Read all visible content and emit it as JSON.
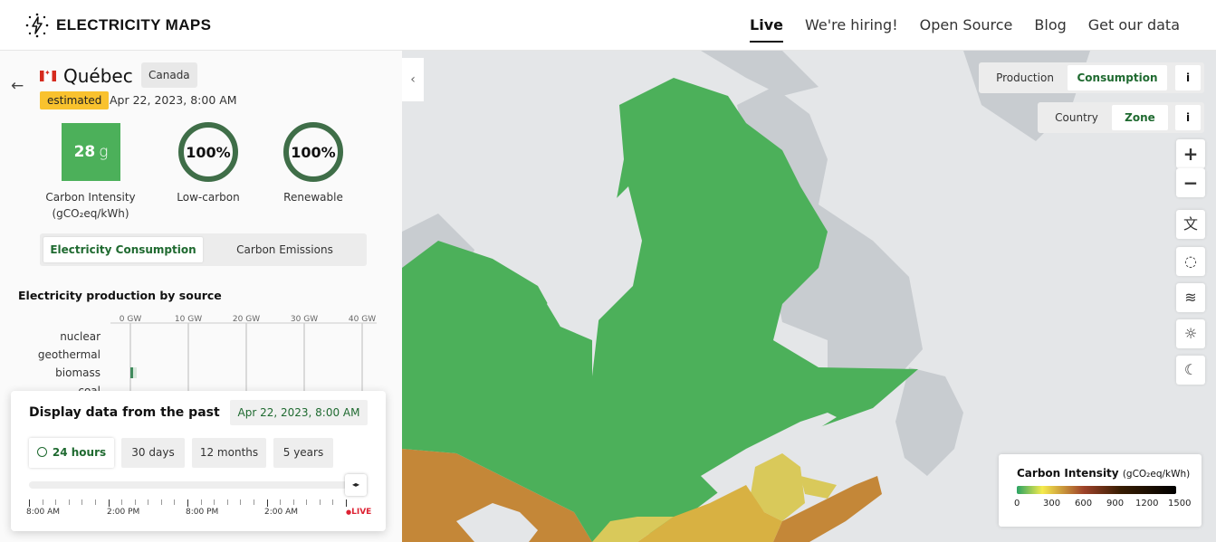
{
  "header": {
    "logo_text": "ELECTRICITY MAPS",
    "nav": [
      "Live",
      "We're hiring!",
      "Open Source",
      "Blog",
      "Get our data"
    ]
  },
  "zone": {
    "name": "Québec",
    "country": "Canada",
    "status": "estimated",
    "datetime": "Apr 22, 2023, 8:00 AM",
    "carbon_intensity_value": "28",
    "carbon_intensity_unit": "g",
    "carbon_intensity_label": "Carbon Intensity",
    "carbon_intensity_sublabel": "(gCO₂eq/kWh)",
    "low_carbon_value": "100%",
    "low_carbon_label": "Low-carbon",
    "renewable_value": "100%",
    "renewable_label": "Renewable",
    "low_carbon_fraction": 1.0,
    "renewable_fraction": 1.0
  },
  "mode_toggle": {
    "options": [
      "Electricity Consumption",
      "Carbon Emissions"
    ],
    "selected": "Electricity Consumption"
  },
  "production_chart": {
    "title": "Electricity production by source",
    "x_ticks": [
      "0 GW",
      "10 GW",
      "20 GW",
      "30 GW",
      "40 GW"
    ],
    "sources": [
      "nuclear",
      "geothermal",
      "biomass",
      "coal"
    ],
    "values_gw": [
      0,
      0,
      0.3,
      0
    ],
    "bar_color": "#3f8a5c"
  },
  "history": {
    "title": "Display data from the past",
    "selected_datetime": "Apr 22, 2023, 8:00 AM",
    "ranges": [
      "24 hours",
      "30 days",
      "12 months",
      "5 years"
    ],
    "selected_range": "24 hours",
    "time_labels": [
      "8:00 AM",
      "2:00 PM",
      "8:00 PM",
      "2:00 AM"
    ],
    "live_label": "LIVE",
    "slider_handle_glyph": "◂▸"
  },
  "map_controls": {
    "production_consumption": [
      "Production",
      "Consumption"
    ],
    "production_consumption_selected": "Consumption",
    "country_zone": [
      "Country",
      "Zone"
    ],
    "country_zone_selected": "Zone",
    "info_label": "i",
    "zoom_in": "+",
    "zoom_out": "−"
  },
  "legend": {
    "title": "Carbon Intensity",
    "unit": "(gCO₂eq/kWh)",
    "ticks": [
      "0",
      "300",
      "600",
      "900",
      "1200",
      "1500"
    ]
  },
  "colors": {
    "quebec_green": "#4cb05a",
    "accent_green": "#1f6a30",
    "estimated_yellow": "#f9c22e",
    "ontario_brown": "#c48738",
    "maritime_yellow": "#d9c95a",
    "live_red": "#d22233"
  }
}
